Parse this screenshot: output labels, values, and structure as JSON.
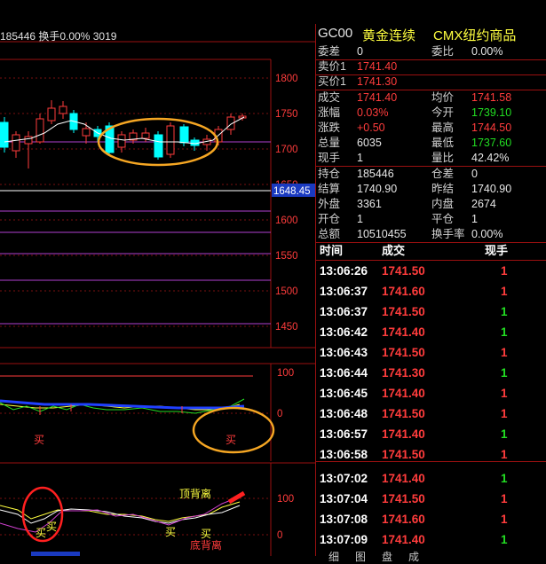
{
  "top_bar": {
    "text": "185446 换手0.00% 3019"
  },
  "main_chart": {
    "current_price_tag": "1648.45",
    "y_ticks": [
      "1800",
      "1750",
      "1700",
      "1650",
      "1600",
      "1550",
      "1500",
      "1450"
    ]
  },
  "indicator1": {
    "y_ticks": [
      "100",
      "0"
    ],
    "signals": [
      "买",
      "买"
    ]
  },
  "indicator2": {
    "y_ticks": [
      "100",
      "0"
    ],
    "labels": {
      "top_divergence": "顶背离",
      "bottom_divergence": "底背离",
      "buy": "买"
    }
  },
  "header": {
    "code": "GC00",
    "name": "黄金连续",
    "market": "CMX纽约商品"
  },
  "quote": {
    "weicha_label": "委差",
    "weicha": "0",
    "weibi_label": "委比",
    "weibi": "0.00%",
    "ask1_label": "卖价1",
    "ask1": "1741.40",
    "bid1_label": "买价1",
    "bid1": "1741.30",
    "last_label": "成交",
    "last": "1741.40",
    "avg_label": "均价",
    "avg": "1741.58",
    "pct_label": "涨幅",
    "pct": "0.03%",
    "open_label": "今开",
    "open": "1739.10",
    "chg_label": "涨跌",
    "chg": "+0.50",
    "high_label": "最高",
    "high": "1744.50",
    "vol_label": "总量",
    "vol": "6035",
    "low_label": "最低",
    "low": "1737.60",
    "cur_label": "现手",
    "cur": "1",
    "volratio_label": "量比",
    "volratio": "42.42%",
    "oi_label": "持仓",
    "oi": "185446",
    "oichg_label": "仓差",
    "oichg": "0",
    "settle_label": "结算",
    "settle": "1740.90",
    "prevsettle_label": "昨结",
    "prevsettle": "1740.90",
    "outer_label": "外盘",
    "outer": "3361",
    "inner_label": "内盘",
    "inner": "2674",
    "kaicang_label": "开仓",
    "kaicang": "1",
    "pingcang_label": "平仓",
    "pingcang": "1",
    "amount_label": "总额",
    "amount": "10510455",
    "turnover_label": "换手率",
    "turnover": "0.00%"
  },
  "trades_header": {
    "time": "时间",
    "price": "成交",
    "hand": "现手"
  },
  "trades": [
    {
      "time": "13:06:26",
      "price": "1741.50",
      "hand": "1",
      "dir": "red"
    },
    {
      "time": "13:06:37",
      "price": "1741.60",
      "hand": "1",
      "dir": "red"
    },
    {
      "time": "13:06:37",
      "price": "1741.50",
      "hand": "1",
      "dir": "green"
    },
    {
      "time": "13:06:42",
      "price": "1741.40",
      "hand": "1",
      "dir": "green"
    },
    {
      "time": "13:06:43",
      "price": "1741.50",
      "hand": "1",
      "dir": "red"
    },
    {
      "time": "13:06:44",
      "price": "1741.30",
      "hand": "1",
      "dir": "green"
    },
    {
      "time": "13:06:45",
      "price": "1741.40",
      "hand": "1",
      "dir": "red"
    },
    {
      "time": "13:06:48",
      "price": "1741.50",
      "hand": "1",
      "dir": "red"
    },
    {
      "time": "13:06:57",
      "price": "1741.40",
      "hand": "1",
      "dir": "green"
    },
    {
      "time": "13:06:58",
      "price": "1741.50",
      "hand": "1",
      "dir": "red"
    },
    {
      "time": "13:07:02",
      "price": "1741.40",
      "hand": "1",
      "dir": "green"
    },
    {
      "time": "13:07:04",
      "price": "1741.50",
      "hand": "1",
      "dir": "red"
    },
    {
      "time": "13:07:08",
      "price": "1741.60",
      "hand": "1",
      "dir": "red"
    },
    {
      "time": "13:07:09",
      "price": "1741.40",
      "hand": "1",
      "dir": "green"
    }
  ],
  "bottom_tabs": [
    "细",
    "图",
    "盘",
    "成"
  ],
  "colors": {
    "up": "#ff3c3c",
    "down": "#22dd22",
    "candle_down": "#00ffff",
    "grid": "#9a1010",
    "annotation": "#f5a623"
  }
}
